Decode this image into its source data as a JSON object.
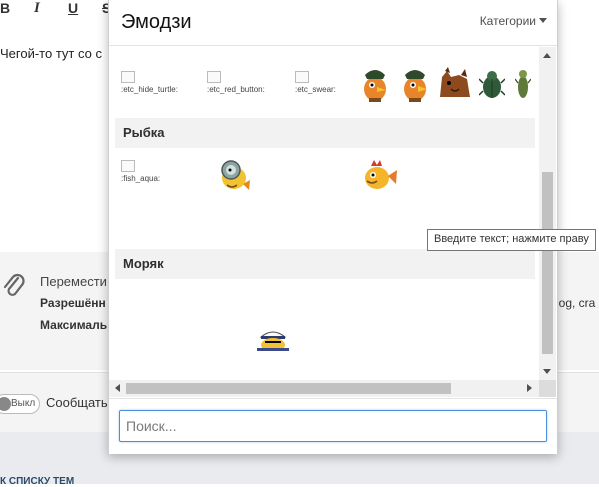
{
  "toolbar": {
    "bold": "B",
    "italic": "I",
    "underline": "U",
    "strike": "S"
  },
  "editor": {
    "text": "Чегой-то тут со с"
  },
  "attachments": {
    "line1": "Перемести",
    "line2": "Разрешённ",
    "line3": "Максималь",
    "right_text": "log, cra"
  },
  "tooltip": "Введите текст; нажмите праву",
  "footer": {
    "toggle_label": "Выкл",
    "notify_label": "Сообщать",
    "back_link": "К СПИСКУ ТЕМ"
  },
  "emoji_popup": {
    "title": "Эмодзи",
    "categories_label": "Категории",
    "search_placeholder": "Поиск...",
    "sections": [
      {
        "name": "",
        "broken_images": [
          ":etc_hide_turtle:",
          ":etc_red_button:",
          ":etc_swear:"
        ],
        "stickers": [
          "pirate-bird-sticker",
          "pirate-bird-sticker-2",
          "horse-sticker",
          "beetle-sticker",
          "bug-sticker"
        ]
      },
      {
        "name": "Рыбка",
        "broken_images": [
          ":fish_aqua:"
        ],
        "stickers": [
          "fish-diver-sticker",
          "fish-rooster-sticker"
        ]
      },
      {
        "name": "Моряк",
        "broken_images": [],
        "stickers": [
          "sailor-sticker"
        ]
      }
    ]
  },
  "colors": {
    "accent_focus": "#4a8fd9",
    "header_bg": "#f2f2f2",
    "scroll_thumb": "#c1c1c1"
  }
}
